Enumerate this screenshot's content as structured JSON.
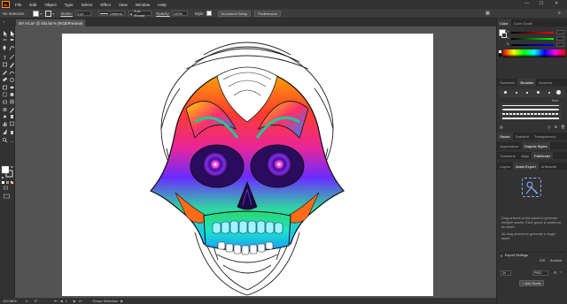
{
  "app": {
    "logo_text": "Ai"
  },
  "menu": [
    "File",
    "Edit",
    "Object",
    "Type",
    "Select",
    "Effect",
    "View",
    "Window",
    "Help"
  ],
  "window_controls": {
    "minimize": "—",
    "maximize": "☐",
    "close": "✕"
  },
  "control_bar": {
    "selection_label": "No Selection",
    "stroke_label": "Stroke:",
    "stroke_value": "1 pt",
    "stroke_profile": "Uniform",
    "brush_value": "5 pt. Round",
    "opacity_label": "Opacity:",
    "opacity_value": "100%",
    "style_label": "Style:",
    "document_setup": "Document Setup",
    "preferences": "Preferences"
  },
  "document_tab": {
    "title": "MY Art.ai* @ 494.56 % (RGB/Preview)",
    "close": "×"
  },
  "status_bar": {
    "zoom": "100.98%",
    "rotation": "0°",
    "page": "1",
    "tool": "Group Selection"
  },
  "panels": {
    "color": {
      "tabs": [
        "Color",
        "Color Guide"
      ],
      "channels": [
        "R",
        "G",
        "B"
      ]
    },
    "brushes": {
      "tabs": [
        "Swatches",
        "Brushes",
        "Symbols"
      ],
      "basic_label": "Basic"
    },
    "stroke": {
      "tabs": [
        "Stroke",
        "Gradient",
        "Transparency"
      ]
    },
    "appearance": {
      "tabs": [
        "Appearance",
        "Graphic Styles"
      ]
    },
    "transform": {
      "tabs": [
        "Transform",
        "Align",
        "Pathfinder"
      ]
    },
    "asset_export": {
      "tabs": [
        "Layers",
        "Asset Export",
        "Artboards"
      ],
      "hint_1": "Drag artwork to this panel to generate multiple assets. Each group is added as an asset.",
      "hint_2": "Alt drag artwork to generate a single asset.",
      "export_settings": "Export Settings",
      "scale_value": "1x",
      "format_value": "PNG",
      "add_scale": "+ Add Scale",
      "ios_label": "iOS",
      "android_label": "Android"
    }
  },
  "colors": {
    "ui_dark": "#323232",
    "canvas": "#535353",
    "artboard": "#ffffff",
    "accent": "#ff9a00"
  }
}
